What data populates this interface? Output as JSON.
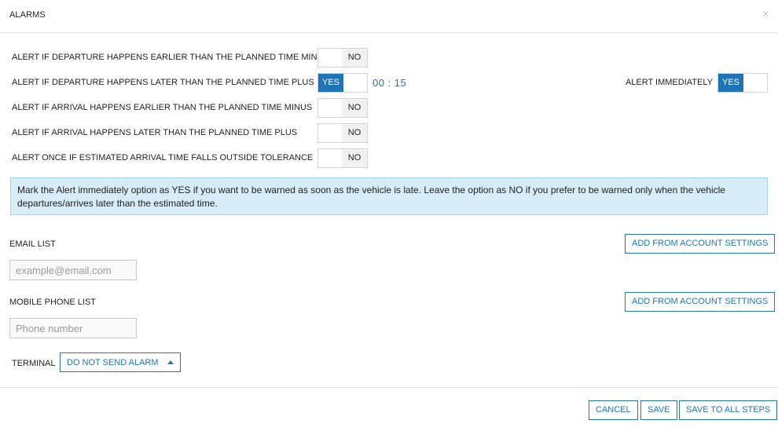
{
  "dialog": {
    "title": "ALARMS",
    "close_icon": "×"
  },
  "alerts": [
    {
      "label": "ALERT IF DEPARTURE HAPPENS EARLIER THAN THE PLANNED TIME MINUS",
      "state": "NO"
    },
    {
      "label": "ALERT IF DEPARTURE HAPPENS LATER THAN THE PLANNED TIME PLUS",
      "state": "YES",
      "time": "00 : 15"
    },
    {
      "label": "ALERT IF ARRIVAL HAPPENS EARLIER THAN THE PLANNED TIME MINUS",
      "state": "NO"
    },
    {
      "label": "ALERT IF ARRIVAL HAPPENS LATER THAN THE PLANNED TIME PLUS",
      "state": "NO"
    },
    {
      "label": "ALERT ONCE IF ESTIMATED ARRIVAL TIME FALLS OUTSIDE TOLERANCE",
      "state": "NO"
    }
  ],
  "alert_immediately": {
    "label": "ALERT IMMEDIATELY",
    "state": "YES"
  },
  "info": "Mark the Alert immediately option as YES if you want to be warned as soon as the vehicle is late. Leave the option as NO if you prefer to be warned only when the vehicle departures/arrives later than the estimated time.",
  "email": {
    "label": "EMAIL LIST",
    "button": "ADD FROM ACCOUNT SETTINGS",
    "placeholder": "example@email.com"
  },
  "phone": {
    "label": "MOBILE PHONE LIST",
    "button": "ADD FROM ACCOUNT SETTINGS",
    "placeholder": "Phone number"
  },
  "terminal": {
    "label": "TERMINAL",
    "selected": "DO NOT SEND ALARM"
  },
  "footer": {
    "cancel": "CANCEL",
    "save": "SAVE",
    "save_all": "SAVE TO ALL STEPS"
  },
  "colors": {
    "accent": "#1f73b7",
    "info_bg": "#d6ecf7",
    "info_border": "#a9d2ea"
  }
}
